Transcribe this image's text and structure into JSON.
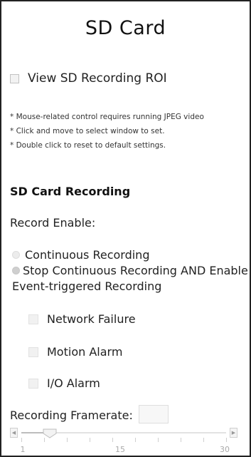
{
  "page": {
    "title": "SD Card"
  },
  "roi": {
    "label": "View SD Recording ROI",
    "checked": false
  },
  "notes": [
    "* Mouse-related control requires running JPEG video",
    "* Click and move to select window to set.",
    "* Double click to reset to default settings."
  ],
  "recording": {
    "heading": "SD Card Recording",
    "enable_label": "Record Enable:",
    "options": [
      {
        "label": "Continuous Recording",
        "selected": false
      },
      {
        "label": "Stop Continuous Recording AND Enable Event-triggered Recording",
        "selected": true
      }
    ],
    "event_options": [
      {
        "label": "Network Failure",
        "checked": false
      },
      {
        "label": "Motion Alarm",
        "checked": false
      },
      {
        "label": "I/O Alarm",
        "checked": false
      }
    ]
  },
  "framerate": {
    "label": "Recording Framerate:",
    "value": "",
    "min": 1,
    "max": 30,
    "current": 5,
    "tick_labels": [
      "1",
      "15",
      "30"
    ]
  }
}
